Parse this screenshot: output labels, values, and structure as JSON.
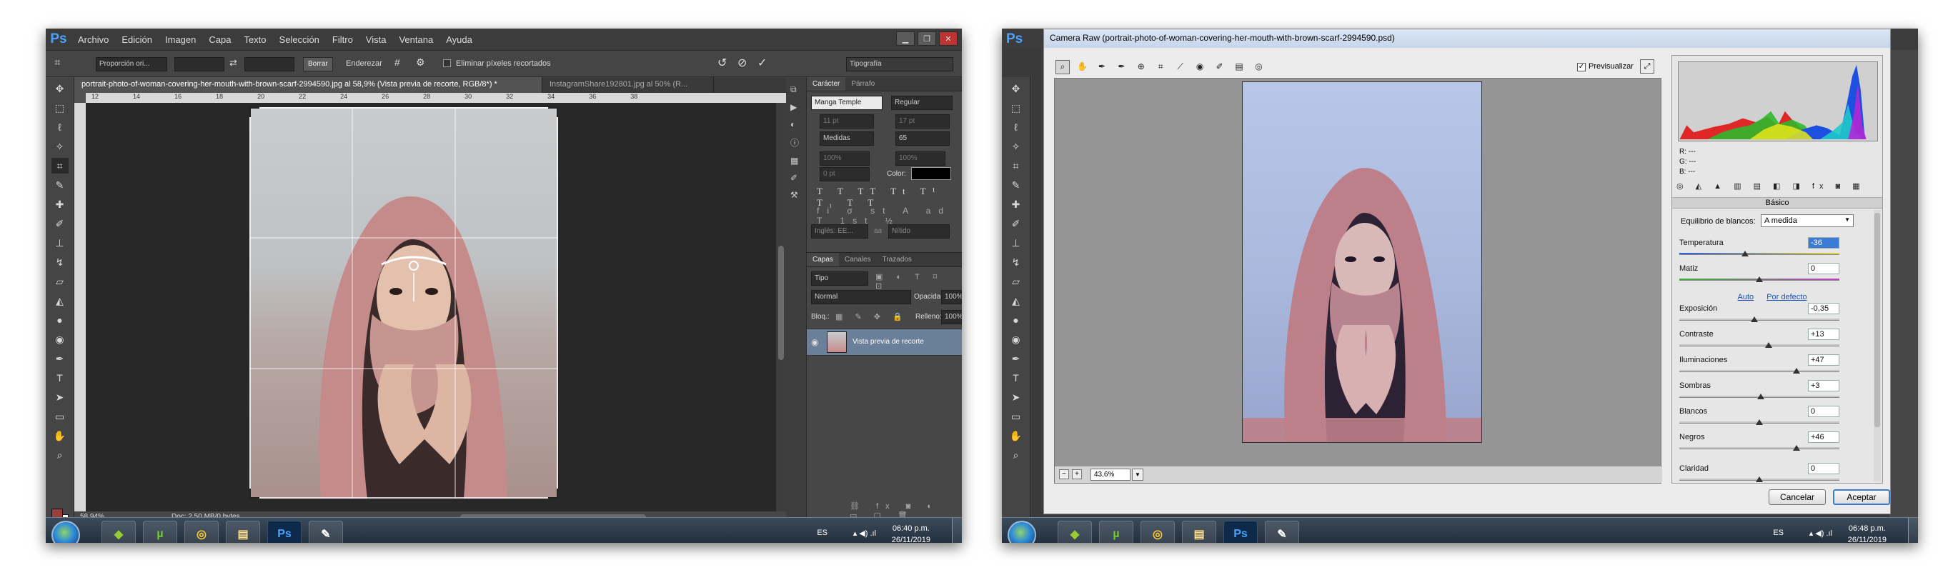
{
  "left": {
    "menu": [
      "Archivo",
      "Edición",
      "Imagen",
      "Capa",
      "Texto",
      "Selección",
      "Filtro",
      "Vista",
      "Ventana",
      "Ayuda"
    ],
    "app_logo": "Ps",
    "options": {
      "ratio": "Proporción ori...",
      "clear": "Borrar",
      "straighten": "Enderezar",
      "delete_cropped": "Eliminar píxeles recortados",
      "workspace": "Tipografía"
    },
    "tabs": [
      "portrait-photo-of-woman-covering-her-mouth-with-brown-scarf-2994590.jpg al 58,9% (Vista previa de recorte, RGB/8*) *",
      "InstagramShare192801.jpg al 50% (R..."
    ],
    "zoom": "58,94%",
    "doc": "Doc: 2,50 MB/0 bytes",
    "character": {
      "tabs": [
        "Carácter",
        "Párrafo"
      ],
      "font": "Manga Temple",
      "style": "Regular",
      "size": "11 pt",
      "leading": "17 pt",
      "kerning": "Medidas",
      "tracking": "65",
      "vscale": "100%",
      "hscale": "100%",
      "baseline": "0 pt",
      "color_label": "Color:",
      "language": "Inglés: EE...",
      "aa_label": "aa",
      "antialias": "Nítido"
    },
    "layers": {
      "tabs": [
        "Capas",
        "Canales",
        "Trazados"
      ],
      "kind": "Tipo",
      "blend": "Normal",
      "opacity_label": "Opacidad:",
      "opacity": "100%",
      "lock_label": "Bloq.:",
      "fill_label": "Relleno:",
      "fill": "100%",
      "layer_name": "Vista previa de recorte"
    },
    "clock": {
      "time": "06:40 p.m.",
      "date": "26/11/2019"
    },
    "lang": "ES",
    "ruler_marks": [
      "12",
      "14",
      "16",
      "18",
      "20",
      "22",
      "24",
      "26",
      "28",
      "30",
      "32",
      "34",
      "36",
      "38"
    ]
  },
  "right": {
    "app_logo": "Ps",
    "title": "Camera Raw (portrait-photo-of-woman-covering-her-mouth-with-brown-scarf-2994590.psd)",
    "preview_label": "Previsualizar",
    "rgb": {
      "r": "R:  ---",
      "g": "G:  ---",
      "b": "B:  ---"
    },
    "section": "Básico",
    "wb_label": "Equilibrio de blancos:",
    "wb_value": "A medida",
    "links": {
      "auto": "Auto",
      "default": "Por defecto"
    },
    "sliders": [
      {
        "label": "Temperatura",
        "value": "-36",
        "level": 0.41
      },
      {
        "label": "Matiz",
        "value": "0",
        "level": 0.5
      },
      {
        "label": "Exposición",
        "value": "-0,35",
        "level": 0.47
      },
      {
        "label": "Contraste",
        "value": "+13",
        "level": 0.56
      },
      {
        "label": "Iluminaciones",
        "value": "+47",
        "level": 0.73
      },
      {
        "label": "Sombras",
        "value": "+3",
        "level": 0.51
      },
      {
        "label": "Blancos",
        "value": "0",
        "level": 0.5
      },
      {
        "label": "Negros",
        "value": "+46",
        "level": 0.73
      },
      {
        "label": "Claridad",
        "value": "0",
        "level": 0.5
      }
    ],
    "zoom": "43,6%",
    "buttons": {
      "cancel": "Cancelar",
      "ok": "Aceptar"
    },
    "clock": {
      "time": "06:48 p.m.",
      "date": "26/11/2019"
    },
    "lang": "ES"
  },
  "colors": {
    "ps_dark": "#535353",
    "ps_blue": "#4aa3ff",
    "layer_selected": "#6a7f99",
    "scarf": "#c58b8b",
    "preview_sky": "#b8c6e8"
  },
  "icons": [
    "crop-icon",
    "rotate-icon",
    "cancel-icon",
    "commit-icon",
    "grid-icon",
    "gear-icon",
    "zoom-tool-icon",
    "hand-tool-icon",
    "eyedropper-icon",
    "histogram-icon",
    "eye-icon"
  ]
}
